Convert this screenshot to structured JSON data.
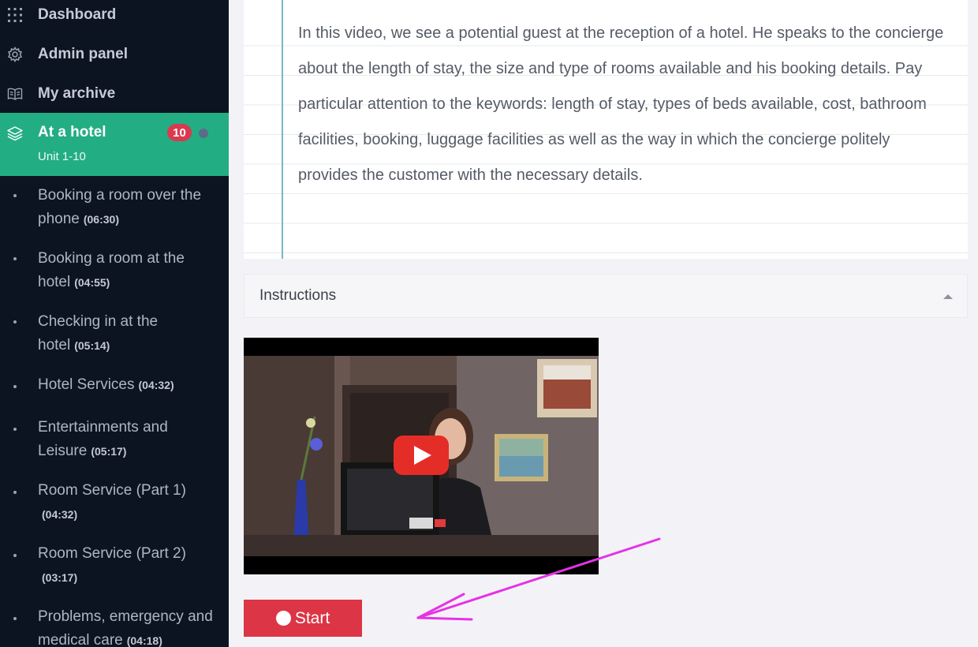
{
  "sidebar": {
    "nav": [
      {
        "label": "Dashboard",
        "icon": "grid-icon"
      },
      {
        "label": "Admin panel",
        "icon": "gear-icon"
      },
      {
        "label": "My archive",
        "icon": "book-icon"
      }
    ],
    "active": {
      "title": "At a hotel",
      "subtitle": "Unit 1-10",
      "badge": "10",
      "icon": "layers-icon"
    },
    "lessons": [
      {
        "title": "Booking a room over the phone",
        "duration": "(06:30)"
      },
      {
        "title": "Booking a room at the hotel",
        "duration": "(04:55)"
      },
      {
        "title": "Checking in at the hotel",
        "duration": "(05:14)"
      },
      {
        "title": "Hotel Services",
        "duration": "(04:32)"
      },
      {
        "title": "Entertainments and Leisure",
        "duration": "(05:17)"
      },
      {
        "title": "Room Service (Part 1)",
        "duration": "(04:32)"
      },
      {
        "title": "Room Service (Part 2)",
        "duration": "(03:17)"
      },
      {
        "title": "Problems, emergency and medical care",
        "duration": "(04:18)"
      }
    ]
  },
  "main": {
    "description": "In this video, we see a potential guest at the reception of a hotel. He speaks to the concierge about the length of stay, the size and type of rooms available and his booking details. Pay particular attention to the keywords: length of stay, types of beds available, cost, bathroom facilities, booking, luggage facilities as well as the way in which the concierge politely provides the customer with the necessary details.",
    "instructions_label": "Instructions",
    "start_label": "Start"
  },
  "colors": {
    "sidebar_bg": "#0d1421",
    "active_bg": "#23ad82",
    "badge_bg": "#d93a4f",
    "start_bg": "#dc3545",
    "annotation_arrow": "#e632e6"
  }
}
